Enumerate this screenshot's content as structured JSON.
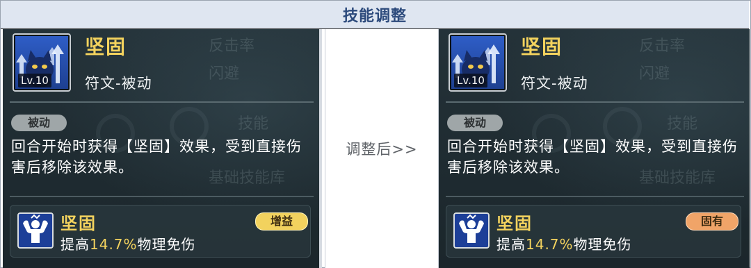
{
  "header": {
    "title": "技能调整"
  },
  "middle": {
    "text": "调整后>>"
  },
  "panels": [
    {
      "skill": {
        "level": "Lv.10",
        "name": "坚固",
        "type": "符文-被动"
      },
      "passive_tag": "被动",
      "description": "回合开始时获得【坚固】效果，受到直接伤害后移除该效果。",
      "buff": {
        "name": "坚固",
        "desc_prefix": "提高",
        "desc_value": "14.7%",
        "desc_suffix": "物理免伤",
        "tag": "增益"
      }
    },
    {
      "skill": {
        "level": "Lv.10",
        "name": "坚固",
        "type": "符文-被动"
      },
      "passive_tag": "被动",
      "description": "回合开始时获得【坚固】效果，受到直接伤害后移除该效果。",
      "buff": {
        "name": "坚固",
        "desc_prefix": "提高",
        "desc_value": "14.7%",
        "desc_suffix": "物理免伤",
        "tag": "固有"
      }
    }
  ],
  "background_ghost_text": [
    "反击率",
    "闪避",
    "技能",
    "基础技能库"
  ],
  "colors": {
    "title_bg": "#dfe6f1",
    "title_text": "#2c4a7c",
    "panel_bg": "#1e2a30",
    "gold": "#f4d35e",
    "buff_tag_left": "#f2d25e",
    "buff_tag_right": "#f0a468"
  },
  "icons": {
    "skill": "cat-spirit-arrows-icon",
    "buff": "muscle-man-icon"
  }
}
